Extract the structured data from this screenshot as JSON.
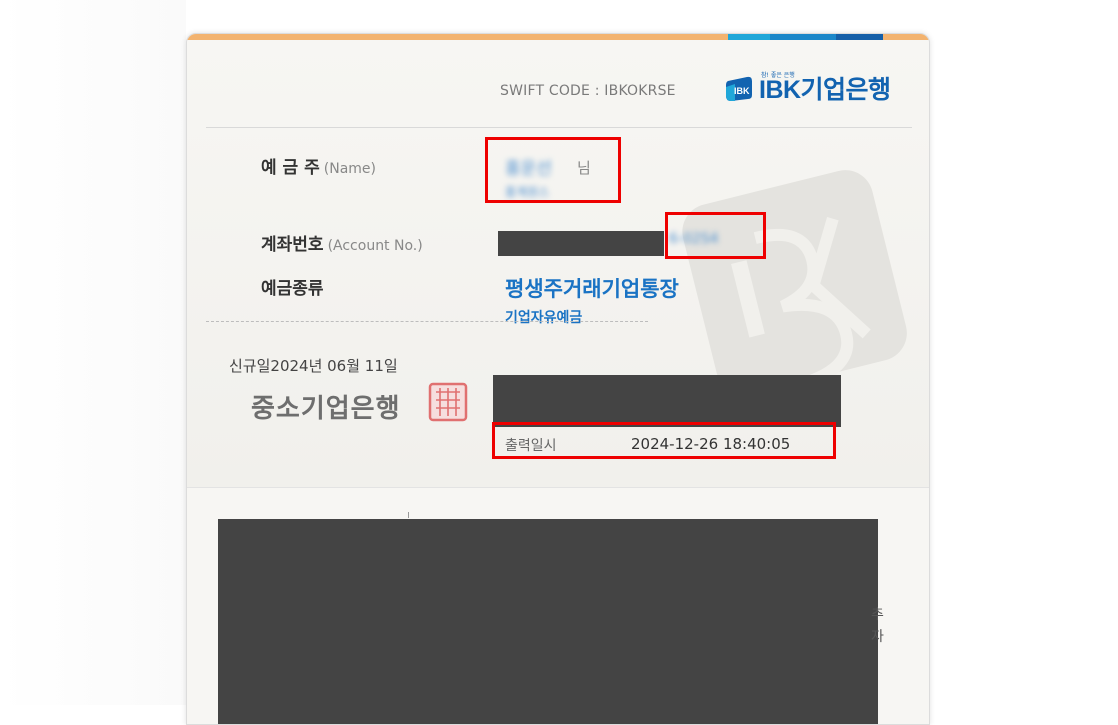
{
  "header": {
    "swift_code": "SWIFT CODE : IBKOKRSE",
    "logo_text": "IBK기업은행",
    "logo_tagline": "참! 좋은 은행",
    "logo_icon": "ibk-logo-icon"
  },
  "fields": {
    "name_label": "예 금 주",
    "name_label_en": "(Name)",
    "name_value": "홍운선",
    "name_suffix": "님",
    "name_sub": "홍계원스",
    "account_label": "계좌번호",
    "account_label_en": "(Account No.)",
    "account_tail": "6-02S4",
    "type_label": "예금종류",
    "product_name": "평생주거래기업통장",
    "product_sub": "기업자유예금"
  },
  "footer": {
    "new_date": "신규일2024년 06월 11일",
    "bank_name": "중소기업은행",
    "seal_icon": "bank-seal-icon",
    "print_label": "출력일시",
    "print_datetime": "2024-12-26 18:40:05"
  },
  "lower_edge": {
    "char1": "추",
    "char2": "자"
  },
  "colors": {
    "accent_orange": "#f3b36f",
    "brand_blue": "#1263b0",
    "product_blue": "#1a73c4",
    "highlight_red": "#ee0000",
    "redaction_gray": "#444444"
  }
}
